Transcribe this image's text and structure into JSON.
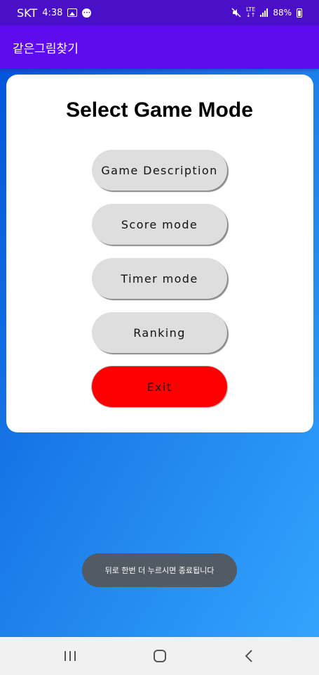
{
  "status_bar": {
    "carrier": "SKT",
    "time": "4:38",
    "network": "LTE",
    "battery": "88%"
  },
  "app_bar": {
    "title": "같은그림찾기"
  },
  "main": {
    "title": "Select Game Mode",
    "buttons": [
      {
        "label": "Game Description"
      },
      {
        "label": "Score mode"
      },
      {
        "label": "Timer mode"
      },
      {
        "label": "Ranking"
      },
      {
        "label": "Exit"
      }
    ]
  },
  "toast": {
    "message": "뒤로 한번 더 누르시면 종료됩니다"
  },
  "nav_bar": {
    "buttons": [
      {
        "icon": "recents-icon"
      },
      {
        "icon": "home-icon"
      },
      {
        "icon": "back-icon"
      }
    ]
  },
  "colors": {
    "status_bar": "#4a10c8",
    "app_bar": "#5e0cee",
    "button": "#dedede",
    "exit_button": "#ff0000",
    "toast": "#525a63"
  }
}
